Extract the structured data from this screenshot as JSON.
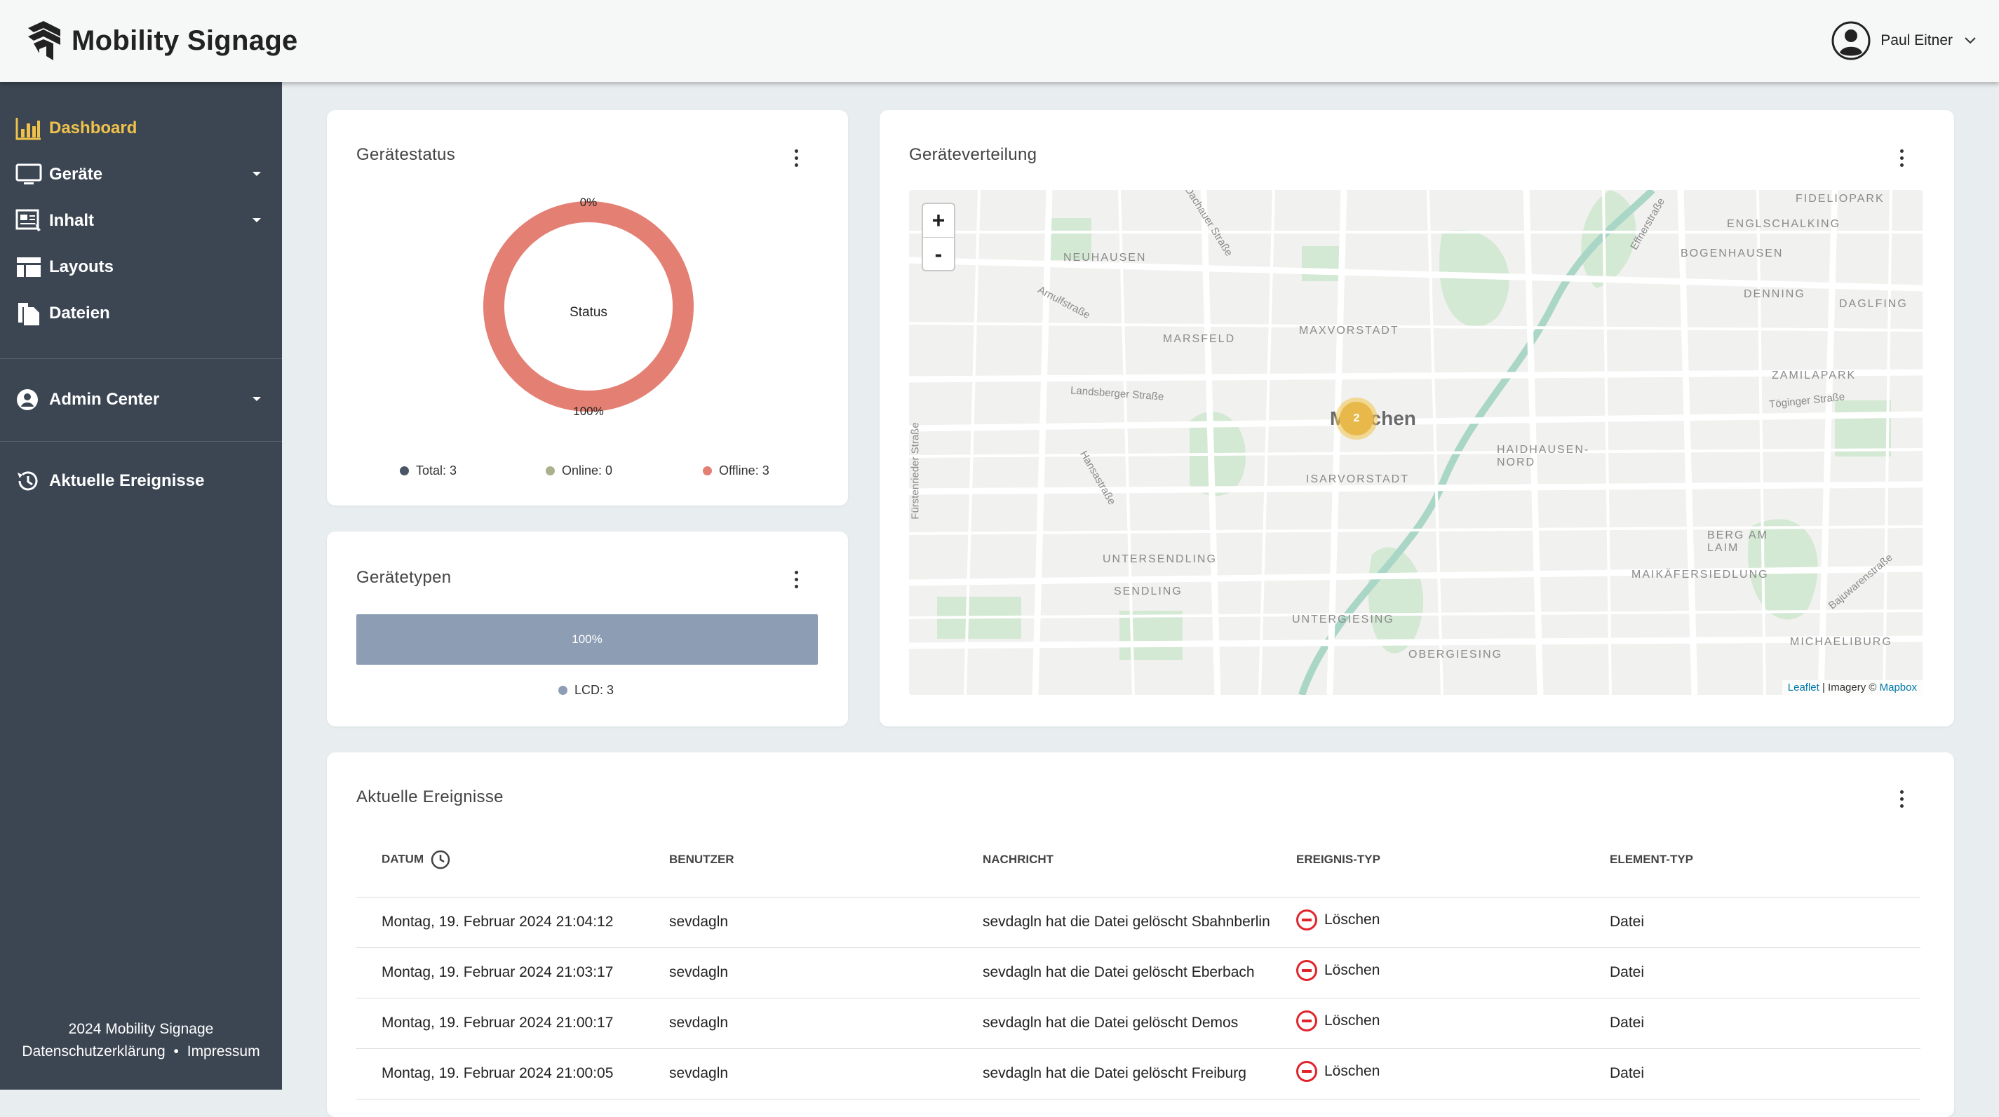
{
  "brand": {
    "name": "Mobility Signage"
  },
  "user": {
    "name": "Paul Eitner"
  },
  "sidebar": {
    "items": [
      {
        "label": "Dashboard",
        "icon": "chart-bar-icon",
        "active": true
      },
      {
        "label": "Geräte",
        "icon": "monitor-icon",
        "expandable": true
      },
      {
        "label": "Inhalt",
        "icon": "content-icon",
        "expandable": true
      },
      {
        "label": "Layouts",
        "icon": "layout-icon"
      },
      {
        "label": "Dateien",
        "icon": "files-icon"
      },
      {
        "label": "Admin Center",
        "icon": "user-circle-icon",
        "expandable": true
      },
      {
        "label": "Aktuelle Ereignisse",
        "icon": "history-icon"
      }
    ],
    "footer": {
      "copyright": "2024 Mobility Signage",
      "privacy": "Datenschutzerklärung",
      "separator": "•",
      "imprint": "Impressum"
    }
  },
  "status_card": {
    "title": "Gerätestatus",
    "center_label": "Status",
    "top_pct": "0%",
    "bottom_pct": "100%",
    "legend": [
      {
        "label": "Total: 3",
        "color": "#4a5666"
      },
      {
        "label": "Online: 0",
        "color": "#a9b08c"
      },
      {
        "label": "Offline: 3",
        "color": "#e47f73"
      }
    ],
    "online_fraction": 0,
    "offline_fraction": 1,
    "ring_color": "#e47f73"
  },
  "types_card": {
    "title": "Gerätetypen",
    "bar_label": "100%",
    "bar_fraction": 1,
    "bar_color": "#8c9db4",
    "legend": [
      {
        "label": "LCD: 3",
        "color": "#8c9db4"
      }
    ]
  },
  "map_card": {
    "title": "Geräteverteilung",
    "zoom_in": "+",
    "zoom_out": "-",
    "cluster_count": "2",
    "city": "München",
    "labels": [
      "NEUHAUSEN",
      "MAXVORSTADT",
      "MARSFELD",
      "ISARVORSTADT",
      "HAIDHAUSEN-NORD",
      "UNTERSENDLING",
      "SENDLING",
      "UNTERGIESING",
      "OBERGIESING",
      "BOGENHAUSEN",
      "ENGLSCHALKING",
      "DENNING",
      "DAGLFING",
      "ZAMILAPARK",
      "FIDELIOPARK",
      "MAIKÄFERSIEDLUNG",
      "MICHAELIBURG",
      "BERG AM LAIM"
    ],
    "streets": [
      "Landsberger Straße",
      "Arnulfstraße",
      "Dachauer Straße",
      "Töginger Straße",
      "Hansastraße",
      "Fürstenrieder Straße",
      "Effnerstraße",
      "Bajuwarenstraße"
    ],
    "attribution_leaflet": "Leaflet",
    "attribution_rest": " | Imagery © ",
    "attribution_mapbox": "Mapbox"
  },
  "events_card": {
    "title": "Aktuelle Ereignisse",
    "columns": [
      "DATUM",
      "BENUTZER",
      "NACHRICHT",
      "EREIGNIS-TYP",
      "ELEMENT-TYP"
    ],
    "rows": [
      {
        "date": "Montag, 19. Februar 2024 21:04:12",
        "user": "sevdagln",
        "message": "sevdagln hat die Datei gelöscht Sbahnberlin",
        "type": "Löschen",
        "element": "Datei"
      },
      {
        "date": "Montag, 19. Februar 2024 21:03:17",
        "user": "sevdagln",
        "message": "sevdagln hat die Datei gelöscht Eberbach",
        "type": "Löschen",
        "element": "Datei"
      },
      {
        "date": "Montag, 19. Februar 2024 21:00:17",
        "user": "sevdagln",
        "message": "sevdagln hat die Datei gelöscht Demos",
        "type": "Löschen",
        "element": "Datei"
      },
      {
        "date": "Montag, 19. Februar 2024 21:00:05",
        "user": "sevdagln",
        "message": "sevdagln hat die Datei gelöscht Freiburg",
        "type": "Löschen",
        "element": "Datei"
      }
    ]
  }
}
